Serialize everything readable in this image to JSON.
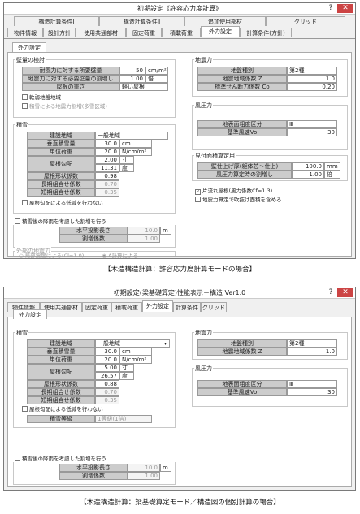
{
  "w1": {
    "title": "初期設定《許容応力度計算》",
    "tabs_r1": [
      "構造計算条件Ⅰ",
      "構造計算条件Ⅱ",
      "追加使用部材",
      "グリッド"
    ],
    "tabs_r2": [
      "物件情報",
      "設計方針",
      "使用共通部材",
      "固定荷重",
      "積載荷重",
      "外力設定",
      "計算条件(方針)"
    ],
    "subtab": "外力設定",
    "wall": {
      "label": "壁量の検討",
      "rows": [
        {
          "l": "耐風力に対する所要壁量",
          "v": "50",
          "u": "cm/m²"
        },
        {
          "l": "地震力に対する必要壁量の割増し",
          "v": "1.00",
          "u": "倍"
        },
        {
          "l": "屋根の重さ",
          "v": "軽い屋根",
          "u": ""
        }
      ],
      "cb1": "軟弱地盤地域",
      "cb2": "積雪による地震力割増(多雪区域)"
    },
    "quake": {
      "label": "地震力",
      "rows": [
        {
          "l": "地盤種別",
          "v": "第2種"
        },
        {
          "l": "地震地域係数 Z",
          "v": "1.0"
        },
        {
          "l": "標準せん断力係数 Co",
          "v": "0.20"
        }
      ]
    },
    "snow": {
      "label": "積雪",
      "rows": [
        {
          "l": "建設地域",
          "v": "一般地域",
          "u": ""
        },
        {
          "l": "垂直積雪量",
          "v": "30.0",
          "u": "cm"
        },
        {
          "l": "単位荷重",
          "v": "20.0",
          "u": "N/cm/m²"
        }
      ],
      "slope_l": "屋根勾配",
      "slope1": "2.00",
      "slope1u": "寸",
      "slope2": "11.31",
      "slope2u": "度",
      "rows2": [
        {
          "l": "屋根形状係数",
          "v": "0.98"
        },
        {
          "l": "長期組合せ係数",
          "v": "0.70"
        },
        {
          "l": "短期組合せ係数",
          "v": "0.35"
        }
      ],
      "cb": "屋根勾配による低減を行わない"
    },
    "wind": {
      "label": "風圧力",
      "rows": [
        {
          "l": "地表面粗度区分",
          "v": "Ⅲ"
        },
        {
          "l": "基準風速Vo",
          "v": "30"
        }
      ]
    },
    "see": {
      "label": "見付面積算定用",
      "rows": [
        {
          "l": "壁仕上げ厚(躯体芯〜仕上)",
          "v": "100.0",
          "u": "mm"
        },
        {
          "l": "風圧力算定時の割増し",
          "v": "1.00",
          "u": "倍"
        }
      ],
      "cb1": "片流れ屋根(風力係数Cf=1.3)",
      "cb2": "地震力算定で吹抜け面積を含める"
    },
    "snowx": {
      "cb": "積雪後の降雨を考慮した割増を行う",
      "rows": [
        {
          "l": "水平投影長さ",
          "v": "10.0",
          "u": "m"
        },
        {
          "l": "割増係数",
          "v": "1.00",
          "u": ""
        }
      ]
    },
    "out": {
      "label": "外部の地震力",
      "r1": "局部震度による(Cl=1.0)",
      "r2": "A計算による"
    }
  },
  "cap1": "【木造構造計算：許容応力度計算モードの場合】",
  "w2": {
    "title": "初期設定(梁基礎算定)性能表示－構造 Ver1.0",
    "tabs": [
      "物件情報",
      "使用共通部材",
      "固定荷重",
      "積載荷重",
      "外力設定",
      "計算条件",
      "グリッド"
    ],
    "subtab": "外力設定",
    "snow": {
      "label": "積雪",
      "rows": [
        {
          "l": "建設地域",
          "v": "一般地域",
          "u": ""
        },
        {
          "l": "垂直積雪量",
          "v": "30.0",
          "u": "cm"
        },
        {
          "l": "単位荷重",
          "v": "20.0",
          "u": "N/cm/m²"
        }
      ],
      "slope_l": "屋根勾配",
      "slope1": "5.00",
      "slope1u": "寸",
      "slope2": "26.57",
      "slope2u": "度",
      "rows2": [
        {
          "l": "屋根形状係数",
          "v": "0.88"
        },
        {
          "l": "長期組合せ係数",
          "v": "0.70"
        },
        {
          "l": "短期組合せ係数",
          "v": "0.35"
        }
      ],
      "cb": "屋根勾配による低減を行わない",
      "grade_l": "積雪等級",
      "grade_v": "1等級(1倍)"
    },
    "quake": {
      "label": "地震力",
      "rows": [
        {
          "l": "地盤種別",
          "v": "第2種"
        },
        {
          "l": "地震地域係数 Z",
          "v": "1.0"
        }
      ]
    },
    "wind": {
      "label": "風圧力",
      "rows": [
        {
          "l": "地表面粗度区分",
          "v": "Ⅲ"
        },
        {
          "l": "基準風速Vo",
          "v": "30"
        }
      ]
    },
    "snowx": {
      "cb": "積雪後の降雨を考慮した割増を行う",
      "rows": [
        {
          "l": "水平投影長さ",
          "v": "10.0",
          "u": "m"
        },
        {
          "l": "割増係数",
          "v": "1.00",
          "u": ""
        }
      ]
    }
  },
  "cap2": "【木造構造計算：梁基礎算定モード／構造図の個別計算の場合】"
}
